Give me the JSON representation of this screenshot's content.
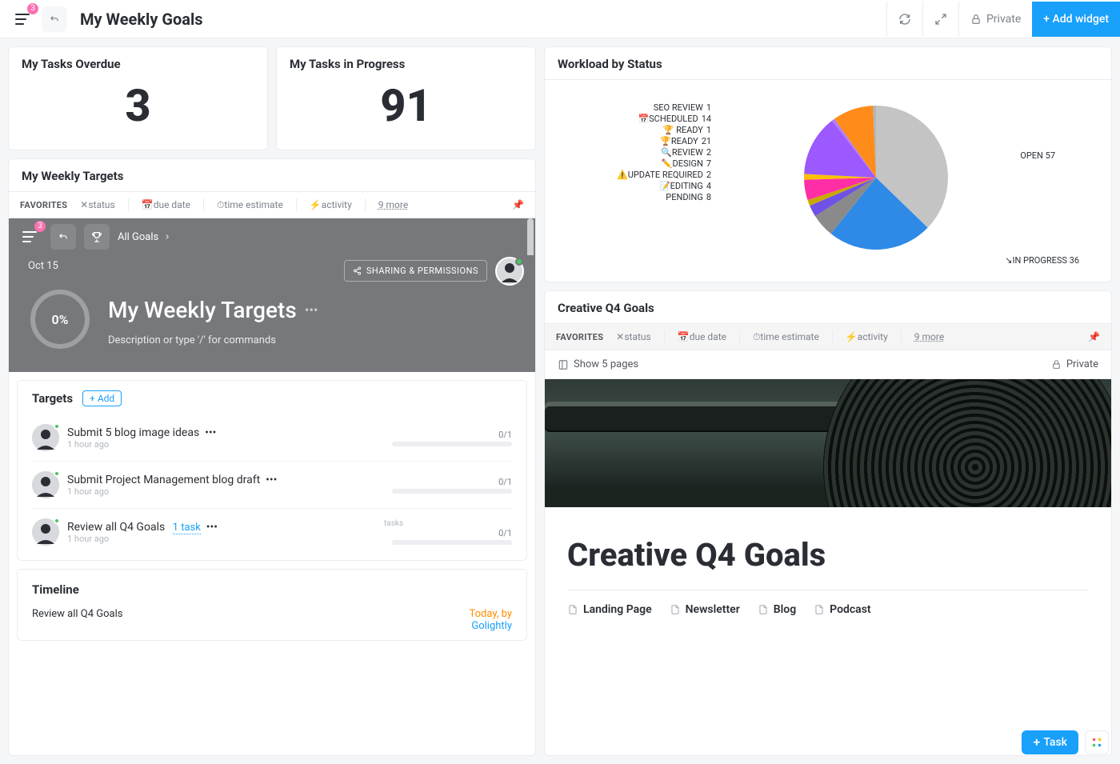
{
  "topbar": {
    "badge": "3",
    "title": "My Weekly Goals",
    "private": "Private",
    "add_widget": "+ Add widget"
  },
  "kpi": {
    "overdue_title": "My Tasks Overdue",
    "overdue_value": "3",
    "progress_title": "My Tasks in Progress",
    "progress_value": "91"
  },
  "filters": {
    "favorites": "FAVORITES",
    "status": "status",
    "due_date": "due date",
    "time_estimate": "time estimate",
    "activity": "activity",
    "more": "9 more"
  },
  "targets_widget": {
    "title": "My Weekly Targets",
    "inner_badge": "3",
    "crumb": "All Goals",
    "date": "Oct 15",
    "sharing": "SHARING & PERMISSIONS",
    "progress": "0%",
    "goal_title": "My Weekly Targets",
    "goal_desc": "Description or type '/' for commands",
    "targets_label": "Targets",
    "add_label": "+ Add",
    "targets": [
      {
        "name": "Submit 5 blog image ideas",
        "time": "1 hour ago",
        "progress": "0/1",
        "tasks_label": ""
      },
      {
        "name": "Submit Project Management blog draft",
        "time": "1 hour ago",
        "progress": "0/1",
        "tasks_label": ""
      },
      {
        "name": "Review all Q4 Goals",
        "time": "1 hour ago",
        "task_link": "1 task",
        "progress": "0/1",
        "tasks_label": "tasks"
      }
    ],
    "timeline_title": "Timeline",
    "timeline_item": "Review all Q4 Goals",
    "timeline_today": "Today",
    "timeline_by": ", by",
    "timeline_who": "Golightly"
  },
  "workload": {
    "title": "Workload by Status"
  },
  "chart_data": {
    "type": "pie",
    "title": "Workload by Status",
    "series": [
      {
        "name": "OPEN",
        "value": 57,
        "color": "#c4c4c4"
      },
      {
        "name": "IN PROGRESS",
        "value": 36,
        "color": "#2e8ae6"
      },
      {
        "name": "PENDING",
        "value": 8,
        "color": "#8a8a8a"
      },
      {
        "name": "📝EDITING",
        "value": 4,
        "color": "#6f51e6"
      },
      {
        "name": "⚠️UPDATE REQUIRED",
        "value": 2,
        "color": "#c9a800"
      },
      {
        "name": "✏️DESIGN",
        "value": 7,
        "color": "#ff2ea6"
      },
      {
        "name": "🔍REVIEW",
        "value": 2,
        "color": "#ffc107"
      },
      {
        "name": "🏆READY",
        "value": 21,
        "color": "#9b59ff"
      },
      {
        "name": "🏆 READY",
        "value": 1,
        "color": "#b47cff"
      },
      {
        "name": "📅SCHEDULED",
        "value": 14,
        "color": "#ff8c1a"
      },
      {
        "name": "SEO REVIEW",
        "value": 1,
        "color": "#b1b6bd"
      }
    ]
  },
  "creative": {
    "title": "Creative Q4 Goals",
    "show_pages": "Show 5 pages",
    "private": "Private",
    "doc_title": "Creative Q4 Goals",
    "pages": [
      "Landing Page",
      "Newsletter",
      "Blog",
      "Podcast"
    ]
  },
  "float": {
    "task": "Task"
  }
}
